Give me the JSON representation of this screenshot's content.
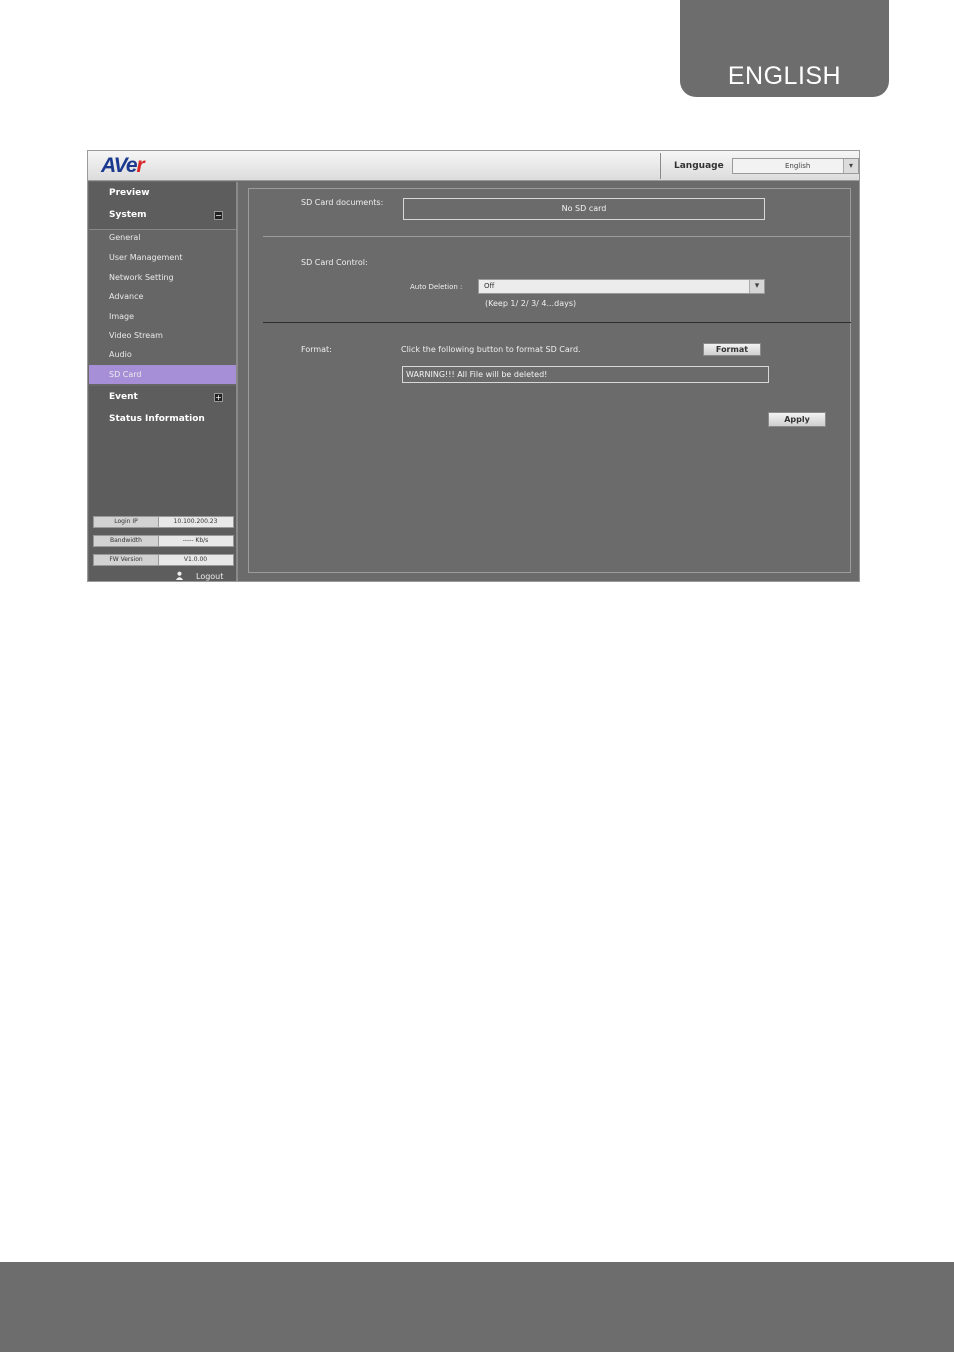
{
  "page_tab": {
    "label": "ENGLISH"
  },
  "app": {
    "logo": {
      "brand_main": "AVe",
      "brand_accent": "r"
    },
    "language": {
      "label": "Language",
      "value": "English"
    },
    "sidebar": {
      "preview": "Preview",
      "system": "System",
      "system_toggle": "−",
      "items": [
        {
          "label": "General"
        },
        {
          "label": "User Management"
        },
        {
          "label": "Network Setting"
        },
        {
          "label": "Advance"
        },
        {
          "label": "Image"
        },
        {
          "label": "Video Stream"
        },
        {
          "label": "Audio"
        },
        {
          "label": "SD Card"
        }
      ],
      "event": "Event",
      "event_toggle": "+",
      "status": "Status Information",
      "info": {
        "login_ip_label": "Login IP",
        "login_ip_value": "10.100.200.23",
        "bandwidth_label": "Bandwidth",
        "bandwidth_value": "----- Kb/s",
        "fw_label": "FW Version",
        "fw_value": "V1.0.00"
      },
      "logout": "Logout"
    },
    "main": {
      "sd_docs_label": "SD Card documents:",
      "sd_docs_value": "No SD card",
      "sd_control_label": "SD Card Control:",
      "auto_deletion_label": "Auto Deletion :",
      "auto_deletion_value": "Off",
      "auto_deletion_hint": "(Keep 1/ 2/ 3/ 4...days)",
      "format_label": "Format:",
      "format_desc": "Click the following button to format SD Card.",
      "format_button": "Format",
      "warning": "WARNING!!! All File will be deleted!",
      "apply_button": "Apply"
    }
  },
  "colors": {
    "tab_gray": "#6d6d6d",
    "app_bg": "#6b6b6b",
    "sidebar_bg": "#5d5d5d",
    "active_item": "#a78fd8",
    "logo_blue": "#1b3a8f",
    "logo_red": "#d8282a"
  },
  "icons": [
    "chevron-down-icon",
    "user-icon",
    "collapse-icon",
    "expand-icon"
  ]
}
